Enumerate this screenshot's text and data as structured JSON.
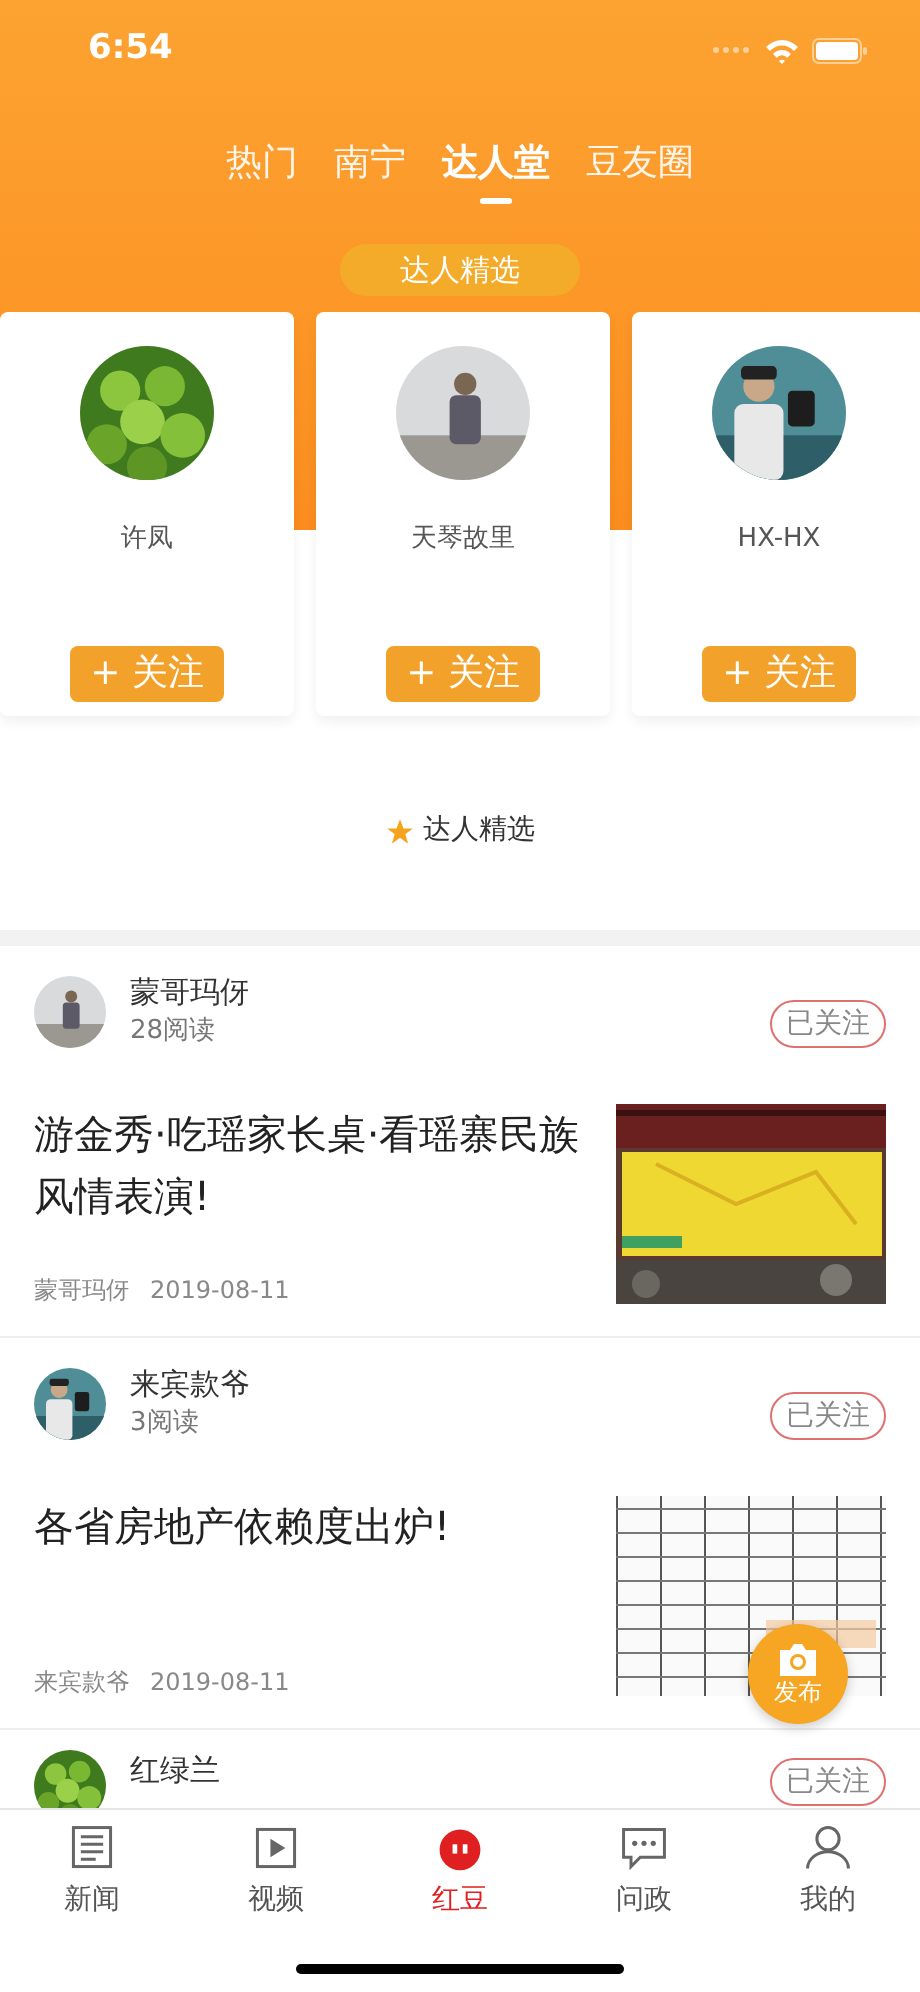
{
  "status_bar": {
    "time": "6:54"
  },
  "top_tabs": [
    {
      "label": "热门",
      "selected": false
    },
    {
      "label": "南宁",
      "selected": false
    },
    {
      "label": "达人堂",
      "selected": true
    },
    {
      "label": "豆友圈",
      "selected": false
    }
  ],
  "featured_label": "达人精选",
  "experts": [
    {
      "name": "许凤",
      "follow": "+ 关注"
    },
    {
      "name": "天琴故里",
      "follow": "+ 关注"
    },
    {
      "name": "HX-HX",
      "follow": "+ 关注"
    }
  ],
  "section_title": "达人精选",
  "posts": [
    {
      "author": "蒙哥玛伢",
      "reads": "28阅读",
      "follow": "已关注",
      "title": "游金秀·吃瑶家长桌·看瑶寨民族风情表演!",
      "meta_author": "蒙哥玛伢",
      "date": "2019-08-11"
    },
    {
      "author": "来宾款爷",
      "reads": "3阅读",
      "follow": "已关注",
      "title": "各省房地产依赖度出炉!",
      "meta_author": "来宾款爷",
      "date": "2019-08-11"
    },
    {
      "author": "红绿兰",
      "follow": "已关注"
    }
  ],
  "publish_button": {
    "label": "发布"
  },
  "bottom_tabs": [
    {
      "label": "新闻",
      "selected": false
    },
    {
      "label": "视频",
      "selected": false
    },
    {
      "label": "红豆",
      "selected": true
    },
    {
      "label": "问政",
      "selected": false
    },
    {
      "label": "我的",
      "selected": false
    }
  ]
}
